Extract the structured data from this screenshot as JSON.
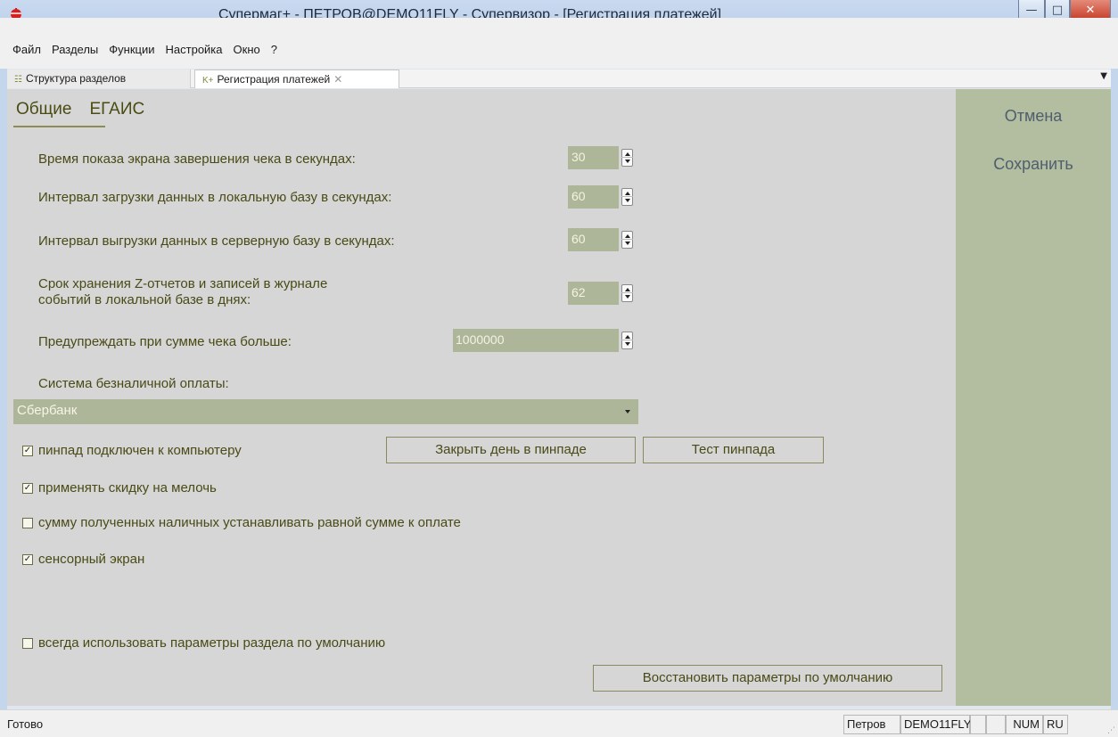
{
  "window": {
    "title": "Супермаг+ - ПЕТРОВ@DEMO11FLY - Супервизор  - [Регистрация платежей]",
    "min": "—",
    "max": "□",
    "close": "✕"
  },
  "menu": [
    "Файл",
    "Разделы",
    "Функции",
    "Настройка",
    "Окно",
    "?"
  ],
  "tabs": {
    "inactive_label": "Структура разделов",
    "active_label": "Регистрация платежей",
    "active_prefix": "K+"
  },
  "subtabs": {
    "general": "Общие",
    "egais": "ЕГАИС"
  },
  "side": {
    "cancel": "Отмена",
    "save": "Сохранить"
  },
  "fields": {
    "receipt_time_label": "Время показа экрана завершения чека в секундах:",
    "receipt_time_value": "30",
    "load_interval_label": "Интервал загрузки данных в локальную базу в секундах:",
    "load_interval_value": "60",
    "unload_interval_label": "Интервал выгрузки данных в серверную базу в секундах:",
    "unload_interval_value": "60",
    "storage_label_1": "Срок хранения Z-отчетов и записей в журнале",
    "storage_label_2": "событий в локальной базе в днях:",
    "storage_value": "62",
    "warn_label": "Предупреждать при сумме чека больше:",
    "warn_value": "1000000",
    "payment_system_label": "Система безналичной оплаты:",
    "payment_system_value": "Сбербанк"
  },
  "checkboxes": {
    "pinpad": {
      "label": "пинпад подключен к компьютеру",
      "checked": true
    },
    "discount": {
      "label": "применять скидку на мелочь",
      "checked": true
    },
    "cash_equal": {
      "label": "сумму полученных наличных устанавливать равной сумме к оплате",
      "checked": false
    },
    "touch": {
      "label": "сенсорный экран",
      "checked": true
    },
    "defaults": {
      "label": "всегда использовать параметры раздела по умолчанию",
      "checked": false
    }
  },
  "buttons": {
    "close_day": "Закрыть день в пинпаде",
    "test_pinpad": "Тест пинпада",
    "restore": "Восстановить параметры по умолчанию"
  },
  "status": {
    "text": "Готово",
    "user": "Петров",
    "db": "DEMO11FLY",
    "num": "NUM",
    "lang": "RU"
  },
  "colors": {
    "field_bg": "#aeb69a",
    "panel_bg": "#d6d6d6",
    "side_bg": "#b3bd9f",
    "label": "#4a4a16"
  }
}
